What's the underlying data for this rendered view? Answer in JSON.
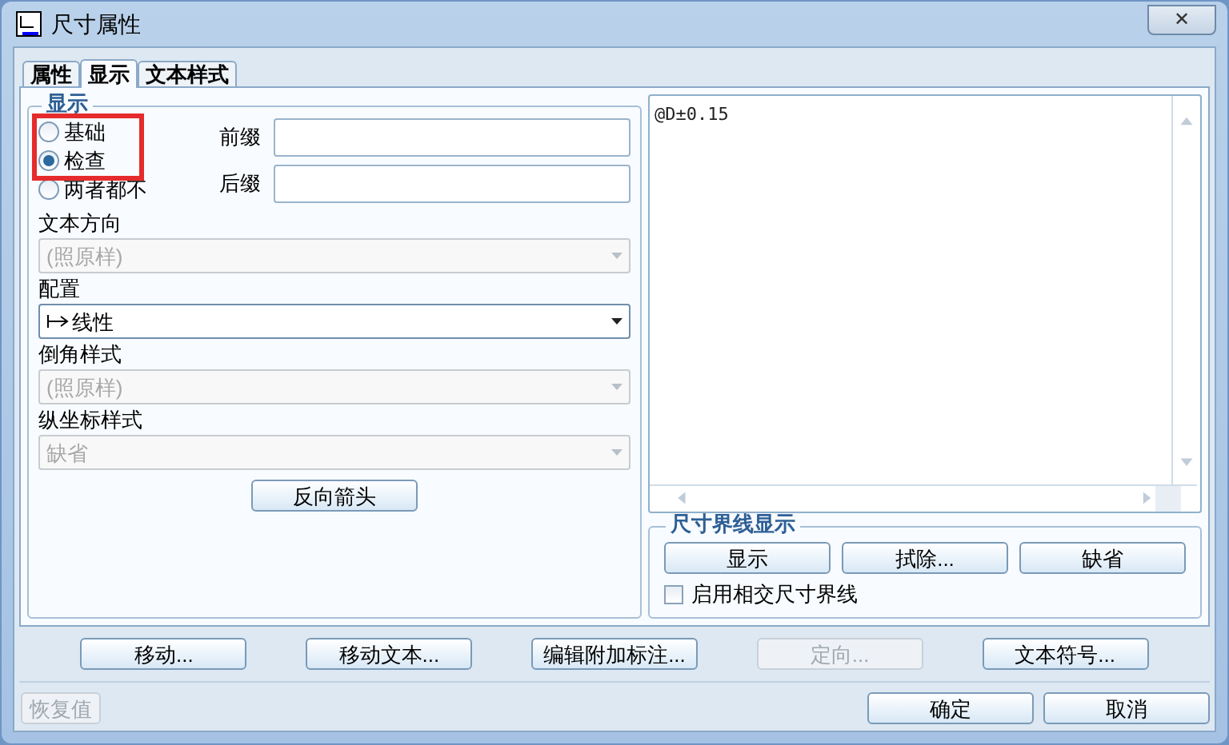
{
  "window": {
    "title": "尺寸属性",
    "close": "✕"
  },
  "tabs": [
    {
      "label": "属性",
      "selected": false
    },
    {
      "label": "显示",
      "selected": true
    },
    {
      "label": "文本样式",
      "selected": false
    }
  ],
  "display_group": {
    "title": "显示",
    "highlight_box": true,
    "radios": [
      {
        "label": "基础",
        "selected": false
      },
      {
        "label": "检查",
        "selected": true
      },
      {
        "label": "两者都不",
        "selected": false
      }
    ],
    "prefix": {
      "label": "前缀"
    },
    "suffix": {
      "label": "后缀"
    },
    "dropdowns": [
      {
        "label": "文本方向",
        "value": "(照原样)",
        "disabled": true,
        "icon": false
      },
      {
        "label": "配置",
        "value": "线性",
        "disabled": false,
        "icon": true
      },
      {
        "label": "倒角样式",
        "value": "(照原样)",
        "disabled": true,
        "icon": false
      },
      {
        "label": "纵坐标样式",
        "value": "缺省",
        "disabled": true,
        "icon": false
      }
    ],
    "reverse_button": "反向箭头"
  },
  "text_area": {
    "value": "@D±0.15"
  },
  "witness_group": {
    "title": "尺寸界线显示",
    "buttons": [
      "显示",
      "拭除...",
      "缺省"
    ],
    "checkbox": {
      "label": "启用相交尺寸界线",
      "checked": false
    }
  },
  "action_buttons": [
    {
      "label": "移动...",
      "disabled": false
    },
    {
      "label": "移动文本...",
      "disabled": false
    },
    {
      "label": "编辑附加标注...",
      "disabled": false
    },
    {
      "label": "定向...",
      "disabled": true
    },
    {
      "label": "文本符号...",
      "disabled": false
    }
  ],
  "footer": {
    "restore": {
      "label": "恢复值",
      "disabled": true
    },
    "ok": "确定",
    "cancel": "取消"
  }
}
